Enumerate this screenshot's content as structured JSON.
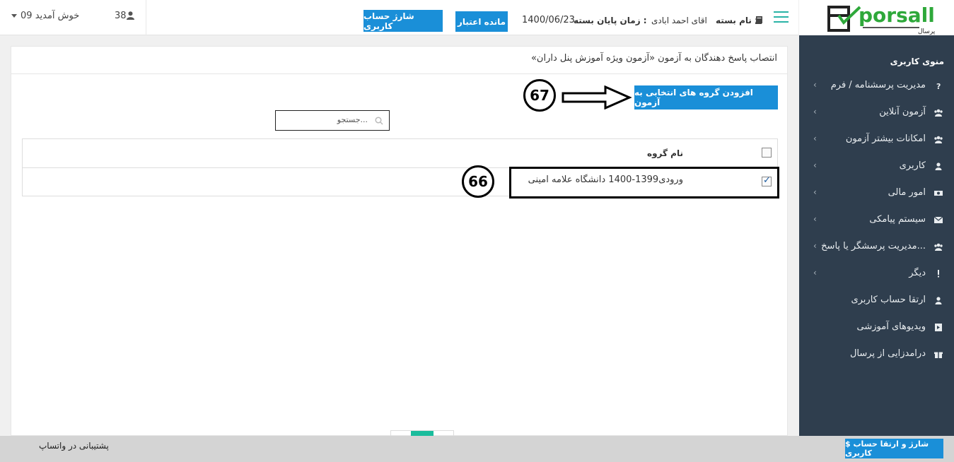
{
  "header": {
    "welcome": "09 خوش آمدید",
    "user_count": "38",
    "charge_account_button": "شارژ حساب کاربری",
    "remaining_credit_button": "مانده اعتبار",
    "end_date_value": "1400/06/23",
    "end_date_label": "زمان پایان بسته :",
    "package_name_value": "اقای احمد ابادی",
    "package_name_label": "نام بسته :"
  },
  "logo": {
    "text": "porsall",
    "subtext": "پرسال"
  },
  "sidebar": {
    "title": "منوی کاربری",
    "items": [
      {
        "label": "مدیریت پرسشنامه / فرم",
        "icon": "question-icon",
        "has_submenu": true
      },
      {
        "label": "آزمون آنلاین",
        "icon": "users-icon",
        "has_submenu": true
      },
      {
        "label": "امکانات بیشتر آزمون",
        "icon": "users-icon",
        "has_submenu": true
      },
      {
        "label": "کاربری",
        "icon": "user-icon",
        "has_submenu": true
      },
      {
        "label": "امور مالی",
        "icon": "money-icon",
        "has_submenu": true
      },
      {
        "label": "سیستم پیامکی",
        "icon": "envelope-icon",
        "has_submenu": true
      },
      {
        "label": "مدیریت پرسشگر یا پاسخ...",
        "icon": "users-icon",
        "has_submenu": true
      },
      {
        "label": "دیگر",
        "icon": "exclamation-icon",
        "has_submenu": true
      },
      {
        "label": "ارتقا حساب کاربری",
        "icon": "user-icon",
        "has_submenu": false
      },
      {
        "label": "ویدیوهای آموزشی",
        "icon": "video-file-icon",
        "has_submenu": false
      },
      {
        "label": "درامدزایی از پرسال",
        "icon": "gift-icon",
        "has_submenu": false
      }
    ]
  },
  "main": {
    "title": "انتصاب پاسخ دهندگان به آزمون «آزمون ویژه آموزش پنل داران»",
    "add_groups_button": "افزودن گروه های انتخابی به آزمون",
    "search_placeholder": "جستجو...",
    "table": {
      "header": "نام گروه",
      "rows": [
        {
          "name": "ورودی1399-1400 دانشگاه علامه امینی",
          "checked": true
        }
      ]
    },
    "annotations": {
      "badge_67": "67",
      "badge_66": "66"
    }
  },
  "footer": {
    "whatsapp_support": "پشتیبانی در واتساپ",
    "charge_upgrade_button": "$ شارژ و ارتقا حساب کاربری"
  },
  "colors": {
    "accent_blue": "#1a8fd8",
    "sidebar_bg": "#2f3e4e",
    "teal": "#1abc9c"
  }
}
